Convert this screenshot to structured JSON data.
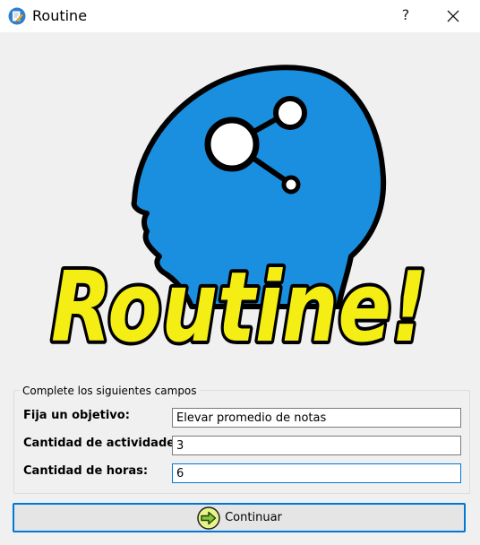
{
  "window": {
    "title": "Routine",
    "help_label": "?",
    "icon": "notepad-pencil-icon",
    "close_icon": "close-icon"
  },
  "logo": {
    "text": "Routine!",
    "colors": {
      "head": "#1a8fe0",
      "text_fill": "#f5ee14",
      "outline": "#000000"
    }
  },
  "form": {
    "group_title": "Complete los siguientes campos",
    "fields": [
      {
        "label": "Fija un objetivo:",
        "value": "Elevar promedio de notas"
      },
      {
        "label": "Cantidad de actividades:",
        "value": "3"
      },
      {
        "label": "Cantidad de horas:",
        "value": "6"
      }
    ]
  },
  "continue_button": {
    "label": "Continuar",
    "icon": "arrow-right-icon"
  },
  "colors": {
    "accent": "#0078d7",
    "background": "#f0f0f0"
  }
}
